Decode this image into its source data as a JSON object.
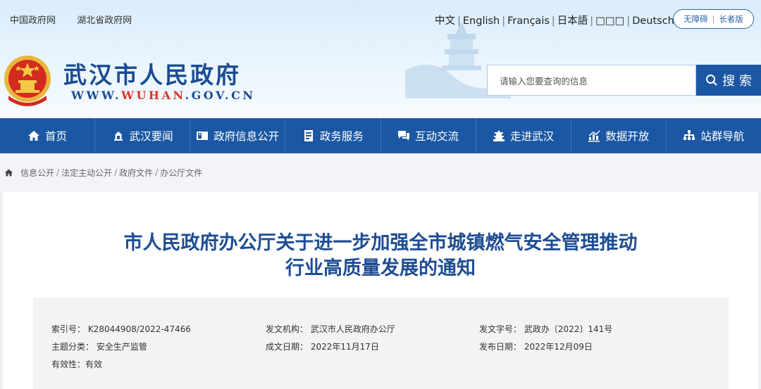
{
  "top_links": [
    "中国政府网",
    "湖北省政府网"
  ],
  "languages": [
    "中文",
    "English",
    "Français",
    "日本語",
    "□□□",
    "Deutsch"
  ],
  "accessibility": {
    "barrier_free": "无障碍",
    "elder": "长者版"
  },
  "site": {
    "title": "武汉市人民政府",
    "url_prefix": "WWW.",
    "url_highlight": "WUHAN",
    "url_suffix": ".GOV.CN"
  },
  "search": {
    "placeholder": "请输入您要查询的信息",
    "button_label": "搜 索"
  },
  "nav": [
    {
      "label": "首页",
      "icon": "home-icon"
    },
    {
      "label": "武汉要闻",
      "icon": "news-icon"
    },
    {
      "label": "政府信息公开",
      "icon": "info-card-icon"
    },
    {
      "label": "政务服务",
      "icon": "service-icon"
    },
    {
      "label": "互动交流",
      "icon": "chat-icon"
    },
    {
      "label": "走进武汉",
      "icon": "tower-icon"
    },
    {
      "label": "数据开放",
      "icon": "chart-icon"
    },
    {
      "label": "站群导航",
      "icon": "sitemap-icon"
    }
  ],
  "breadcrumb": [
    "信息公开",
    "法定主动公开",
    "政府文件",
    "办公厅文件"
  ],
  "document": {
    "title_line1": "市人民政府办公厅关于进一步加强全市城镇燃气安全管理推动",
    "title_line2": "行业高质量发展的通知"
  },
  "meta": {
    "index_no_label": "索引号：",
    "index_no": "K28044908/2022-47466",
    "issuer_label": "发文机构：",
    "issuer": "武汉市人民政府办公厅",
    "doc_no_label": "发文字号：",
    "doc_no": "武政办〔2022〕141号",
    "category_label": "主题分类：",
    "category": "安全生产监管",
    "written_date_label": "成文日期：",
    "written_date": "2022年11月17日",
    "publish_date_label": "发布日期：",
    "publish_date": "2022年12月09日",
    "validity_label": "有效性：",
    "validity": "有效"
  },
  "colors": {
    "brand_blue": "#1b57a3",
    "title_blue": "#1e4d93",
    "url_red": "#d8362a"
  }
}
